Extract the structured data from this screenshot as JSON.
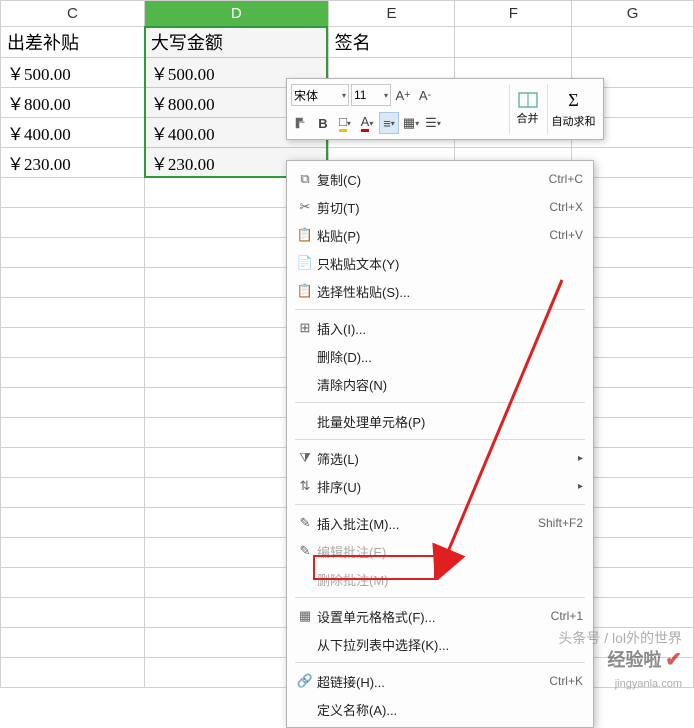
{
  "columns": {
    "C": "C",
    "D": "D",
    "E": "E",
    "F": "F",
    "G": "G"
  },
  "headers": {
    "C": "出差补贴",
    "D": "大写金额",
    "E": "签名"
  },
  "cells": {
    "C": [
      "￥500.00",
      "￥800.00",
      "￥400.00",
      "￥230.00"
    ],
    "D": [
      "￥500.00",
      "￥800.00",
      "￥400.00",
      "￥230.00"
    ]
  },
  "toolbar": {
    "font_name": "宋体",
    "font_size": "11",
    "merge_label": "合并",
    "autosum_label": "自动求和"
  },
  "menu": {
    "copy": "复制(C)",
    "copy_sc": "Ctrl+C",
    "cut": "剪切(T)",
    "cut_sc": "Ctrl+X",
    "paste": "粘贴(P)",
    "paste_sc": "Ctrl+V",
    "paste_text": "只粘贴文本(Y)",
    "paste_special": "选择性粘贴(S)...",
    "insert": "插入(I)...",
    "delete": "删除(D)...",
    "clear": "清除内容(N)",
    "batch": "批量处理单元格(P)",
    "filter": "筛选(L)",
    "sort": "排序(U)",
    "insert_note": "插入批注(M)...",
    "insert_note_sc": "Shift+F2",
    "edit_note": "编辑批注(E)...",
    "del_note": "删除批注(M)",
    "format": "设置单元格格式(F)...",
    "format_sc": "Ctrl+1",
    "dropdown": "从下拉列表中选择(K)...",
    "hyperlink": "超链接(H)...",
    "hyperlink_sc": "Ctrl+K",
    "define_name": "定义名称(A)..."
  },
  "watermark": {
    "line1": "头条号 / lol外的世界",
    "line2_a": "经验啦",
    "line2_b": "jingyanla.com"
  }
}
